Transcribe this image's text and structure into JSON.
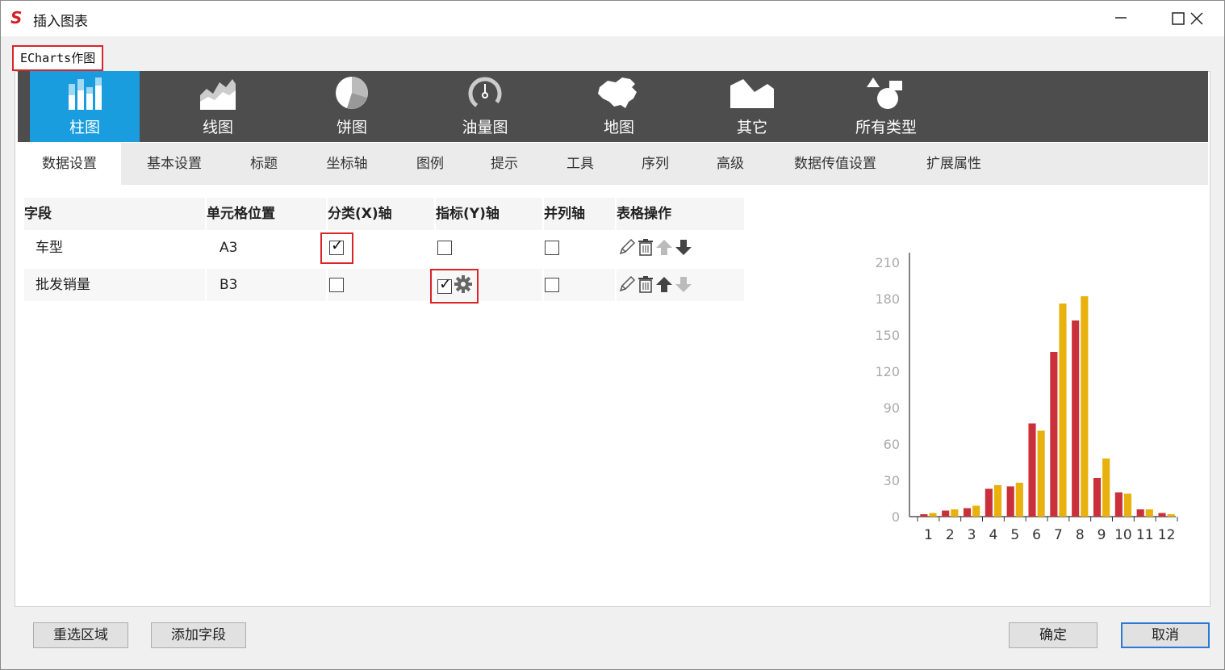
{
  "window": {
    "title": "插入图表"
  },
  "mode_label": "ECharts作图",
  "chart_types": [
    {
      "label": "柱图",
      "icon": "bar-chart-icon",
      "active": true
    },
    {
      "label": "线图",
      "icon": "line-chart-icon"
    },
    {
      "label": "饼图",
      "icon": "pie-chart-icon"
    },
    {
      "label": "油量图",
      "icon": "gauge-icon"
    },
    {
      "label": "地图",
      "icon": "china-map-icon"
    },
    {
      "label": "其它",
      "icon": "other-chart-icon"
    },
    {
      "label": "所有类型",
      "icon": "shapes-icon"
    }
  ],
  "tabs": [
    "数据设置",
    "基本设置",
    "标题",
    "坐标轴",
    "图例",
    "提示",
    "工具",
    "序列",
    "高级",
    "数据传值设置",
    "扩展属性"
  ],
  "active_tab": "数据设置",
  "table": {
    "headers": [
      "字段",
      "单元格位置",
      "分类(X)轴",
      "指标(Y)轴",
      "并列轴",
      "表格操作"
    ],
    "rows": [
      {
        "field": "车型",
        "cell": "A3",
        "x_axis": true,
        "y_axis": false,
        "parallel": false
      },
      {
        "field": "批发销量",
        "cell": "B3",
        "x_axis": false,
        "y_axis": true,
        "parallel": false
      }
    ]
  },
  "chart_data": {
    "type": "bar",
    "categories": [
      "1",
      "2",
      "3",
      "4",
      "5",
      "6",
      "7",
      "8",
      "9",
      "10",
      "11",
      "12"
    ],
    "series": [
      {
        "color": "#c9303a",
        "values": [
          2,
          5,
          7,
          23,
          25,
          77,
          136,
          162,
          32,
          20,
          6,
          3
        ]
      },
      {
        "color": "#e8b10d",
        "values": [
          3,
          6,
          9,
          26,
          28,
          71,
          176,
          182,
          48,
          19,
          6,
          2
        ]
      }
    ],
    "yticks": [
      "0",
      "30",
      "60",
      "90",
      "120",
      "150",
      "180",
      "210"
    ],
    "ylim": [
      0,
      210
    ]
  },
  "buttons": {
    "reselect": "重选区域",
    "add_field": "添加字段",
    "ok": "确定",
    "cancel": "取消"
  },
  "colors": {
    "accent": "#1a9ddf",
    "toolbar": "#4d4d4d",
    "highlight": "#d9252a"
  }
}
